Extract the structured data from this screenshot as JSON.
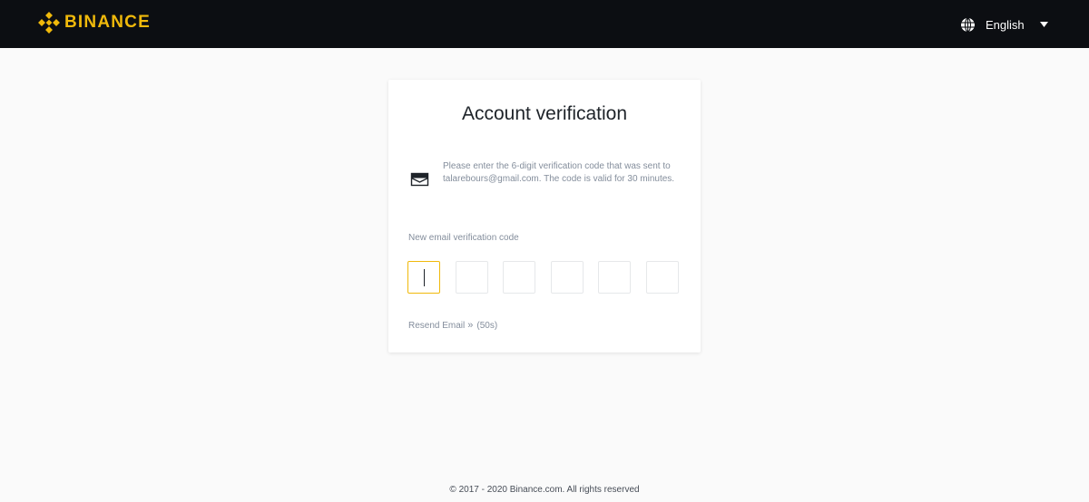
{
  "header": {
    "brand": "BINANCE",
    "language": "English",
    "icons": {
      "logo": "binance-diamond-logo",
      "globe": "globe-icon",
      "caret": "caret-down-icon"
    },
    "colors": {
      "background": "#0c0e12",
      "brand": "#f0b90b"
    }
  },
  "card": {
    "title": "Account verification",
    "info_text": "Please enter the 6-digit verification code that was sent to talarebours@gmail.com. The code is valid for 30 minutes.",
    "code_label": "New email verification code",
    "code_digits": [
      "",
      "",
      "",
      "",
      "",
      ""
    ],
    "resend_label": "Resend Email",
    "resend_arrow": "»",
    "resend_countdown": "(50s)",
    "icons": {
      "info": "envelope-icon"
    }
  },
  "footer": {
    "copyright": "© 2017 - 2020 Binance.com. All rights reserved"
  }
}
